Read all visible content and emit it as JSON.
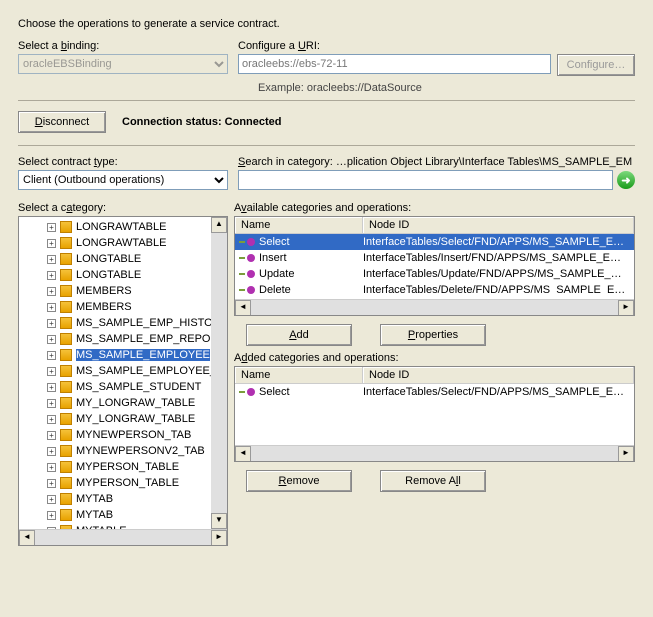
{
  "heading": "Choose the operations to generate a service contract.",
  "binding": {
    "label_pre": "Select a ",
    "label_u": "b",
    "label_post": "inding:",
    "value": "oracleEBSBinding"
  },
  "uri": {
    "label_pre": "Configure a ",
    "label_u": "U",
    "label_post": "RI:",
    "value": "oracleebs://ebs-72-11",
    "example": "Example: oracleebs://DataSource",
    "configure_btn": "Configure…"
  },
  "connect": {
    "disconnect": "Disconnect",
    "status_pre": "Connection status: ",
    "status_val": "Connected"
  },
  "contract": {
    "label_pre": "Select contract ",
    "label_u": "t",
    "label_post": "ype:",
    "value": "Client (Outbound operations)"
  },
  "search": {
    "label_pre": "",
    "label_u": "S",
    "label_post": "earch in category: …plication Object Library\\Interface Tables\\MS_SAMPLE_EM",
    "value": ""
  },
  "categoryLabel": {
    "pre": "Select a c",
    "u": "a",
    "post": "tegory:"
  },
  "availLabel": {
    "pre": "A",
    "u": "v",
    "post": "ailable categories and operations:"
  },
  "addedLabel": {
    "pre": "A",
    "u": "d",
    "post": "ded categories and operations:"
  },
  "cols": {
    "name": "Name",
    "node": "Node ID"
  },
  "buttons": {
    "add": "Add",
    "properties": "Properties",
    "remove": "Remove",
    "removeAll": "Remove All"
  },
  "go_glyph": "➜",
  "treeItems": [
    "LONGRAWTABLE",
    "LONGRAWTABLE",
    "LONGTABLE",
    "LONGTABLE",
    "MEMBERS",
    "MEMBERS",
    "MS_SAMPLE_EMP_HISTORY",
    "MS_SAMPLE_EMP_REPORT",
    "MS_SAMPLE_EMPLOYEE",
    "MS_SAMPLE_EMPLOYEE_REPO",
    "MS_SAMPLE_STUDENT",
    "MY_LONGRAW_TABLE",
    "MY_LONGRAW_TABLE",
    "MYNEWPERSON_TAB",
    "MYNEWPERSONV2_TAB",
    "MYPERSON_TABLE",
    "MYPERSON_TABLE",
    "MYTAB",
    "MYTAB",
    "MYTABLE"
  ],
  "treeSelectedIndex": 8,
  "available": [
    {
      "name": "Select",
      "node": "InterfaceTables/Select/FND/APPS/MS_SAMPLE_E…"
    },
    {
      "name": "Insert",
      "node": "InterfaceTables/Insert/FND/APPS/MS_SAMPLE_E…"
    },
    {
      "name": "Update",
      "node": "InterfaceTables/Update/FND/APPS/MS_SAMPLE_…"
    },
    {
      "name": "Delete",
      "node": "InterfaceTables/Delete/FND/APPS/MS_SAMPLE_E…"
    }
  ],
  "added": [
    {
      "name": "Select",
      "node": "InterfaceTables/Select/FND/APPS/MS_SAMPLE_E…"
    }
  ]
}
